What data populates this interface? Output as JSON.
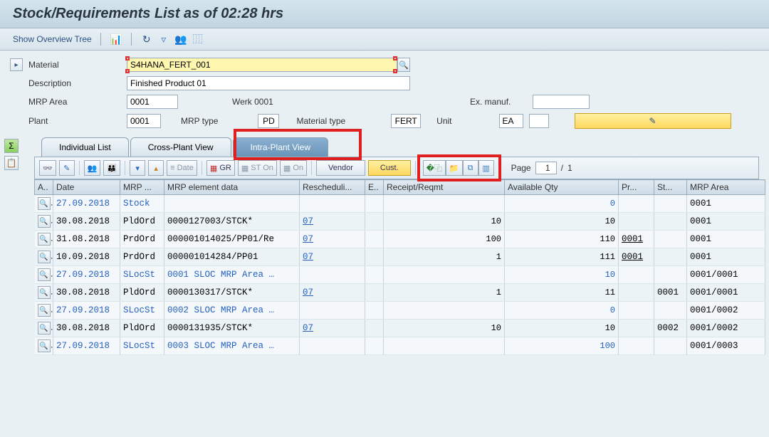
{
  "title": "Stock/Requirements List as of 02:28 hrs",
  "toolbar": {
    "overview_tree": "Show Overview Tree"
  },
  "fields": {
    "material": {
      "label": "Material",
      "value": "S4HANA_FERT_001"
    },
    "description": {
      "label": "Description",
      "value": "Finished Product 01"
    },
    "mrp_area": {
      "label": "MRP Area",
      "value": "0001",
      "extra": "Werk 0001"
    },
    "ex_manuf": {
      "label": "Ex. manuf.",
      "value": ""
    },
    "plant": {
      "label": "Plant",
      "value": "0001"
    },
    "mrp_type": {
      "label": "MRP type",
      "value": "PD"
    },
    "material_type": {
      "label": "Material type",
      "value": "FERT"
    },
    "unit": {
      "label": "Unit",
      "value": "EA"
    }
  },
  "tabs": [
    "Individual List",
    "Cross-Plant View",
    "Intra-Plant View"
  ],
  "active_tab": 2,
  "tbl_toolbar": {
    "date": "Date",
    "gr": "GR",
    "st_on": "ST On",
    "on": "On",
    "vendor": "Vendor",
    "cust": "Cust.",
    "page_label": "Page",
    "page_current": "1",
    "page_total": "1"
  },
  "columns": [
    "A..",
    "Date",
    "MRP ...",
    "MRP element data",
    "Rescheduli...",
    "E..",
    "Receipt/Reqmt",
    "Available Qty",
    "Pr...",
    "St...",
    "MRP Area"
  ],
  "rows": [
    {
      "date": "27.09.2018",
      "date_link": true,
      "el": "Stock",
      "el_link": true,
      "data": "",
      "resched": "",
      "e": "",
      "receipt": "",
      "avail": "0",
      "avail_link": true,
      "pr": "",
      "st": "",
      "area": "0001"
    },
    {
      "date": "30.08.2018",
      "el": "PldOrd",
      "data": "0000127003/STCK*",
      "resched": "07",
      "resched_link": true,
      "e": "",
      "receipt": "10",
      "avail": "10",
      "pr": "",
      "st": "",
      "area": "0001"
    },
    {
      "date": "31.08.2018",
      "el": "PrdOrd",
      "data": "000001014025/PP01/Re",
      "resched": "07",
      "resched_link": true,
      "e": "",
      "receipt": "100",
      "avail": "110",
      "pr": "0001",
      "pr_u": true,
      "st": "",
      "area": "0001"
    },
    {
      "date": "10.09.2018",
      "el": "PrdOrd",
      "data": "000001014284/PP01",
      "resched": "07",
      "resched_link": true,
      "e": "",
      "receipt": "1",
      "avail": "111",
      "pr": "0001",
      "pr_u": true,
      "st": "",
      "area": "0001"
    },
    {
      "date": "27.09.2018",
      "date_link": true,
      "el": "SLocSt",
      "el_link": true,
      "data": "0001 SLOC MRP Area …",
      "data_link": true,
      "resched": "",
      "e": "",
      "receipt": "",
      "avail": "10",
      "avail_link": true,
      "pr": "",
      "st": "",
      "area": "0001/0001"
    },
    {
      "date": "30.08.2018",
      "el": "PldOrd",
      "data": "0000130317/STCK*",
      "resched": "07",
      "resched_link": true,
      "e": "",
      "receipt": "1",
      "avail": "11",
      "pr": "",
      "st": "0001",
      "area": "0001/0001"
    },
    {
      "date": "27.09.2018",
      "date_link": true,
      "el": "SLocSt",
      "el_link": true,
      "data": "0002 SLOC MRP Area …",
      "data_link": true,
      "resched": "",
      "e": "",
      "receipt": "",
      "avail": "0",
      "avail_link": true,
      "pr": "",
      "st": "",
      "area": "0001/0002"
    },
    {
      "date": "30.08.2018",
      "el": "PldOrd",
      "data": "0000131935/STCK*",
      "resched": "07",
      "resched_link": true,
      "e": "",
      "receipt": "10",
      "avail": "10",
      "pr": "",
      "st": "0002",
      "area": "0001/0002"
    },
    {
      "date": "27.09.2018",
      "date_link": true,
      "el": "SLocSt",
      "el_link": true,
      "data": "0003 SLOC MRP Area …",
      "data_link": true,
      "resched": "",
      "e": "",
      "receipt": "",
      "avail": "100",
      "avail_link": true,
      "pr": "",
      "st": "",
      "area": "0001/0003"
    }
  ]
}
